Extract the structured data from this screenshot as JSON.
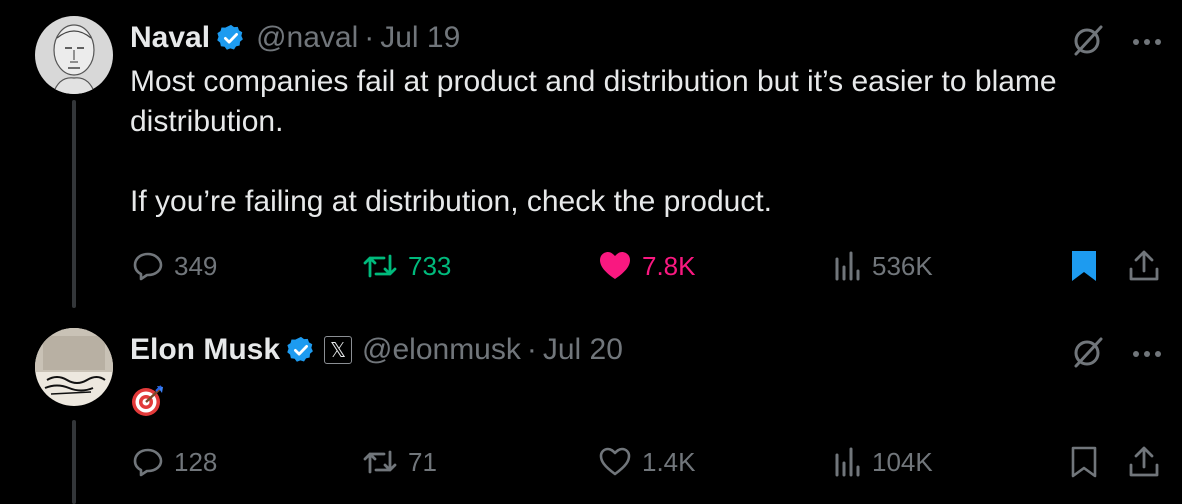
{
  "colors": {
    "background": "#000000",
    "text": "#e7e9ea",
    "muted": "#71767b",
    "verified_blue": "#1d9bf0",
    "retweet_green": "#00ba7c",
    "like_pink": "#f91880",
    "bookmark_active": "#1d9bf0"
  },
  "tweets": [
    {
      "name": "Naval",
      "handle": "@naval",
      "separator": "·",
      "date": "Jul 19",
      "verified": true,
      "body": [
        "Most companies fail at product and distribution but it’s easier to blame distribution.",
        "If you’re failing at distribution, check the product."
      ],
      "stats": {
        "replies": "349",
        "retweets": "733",
        "likes": "7.8K",
        "views": "536K"
      },
      "retweeted": true,
      "liked": true,
      "bookmarked": true
    },
    {
      "name": "Elon Musk",
      "handle": "@elonmusk",
      "separator": "·",
      "date": "Jul 20",
      "verified": true,
      "affiliate_badge": "𝕏",
      "body_icon": "direct-hit-target-emoji",
      "stats": {
        "replies": "128",
        "retweets": "71",
        "likes": "1.4K",
        "views": "104K"
      },
      "retweeted": false,
      "liked": false,
      "bookmarked": false
    }
  ]
}
